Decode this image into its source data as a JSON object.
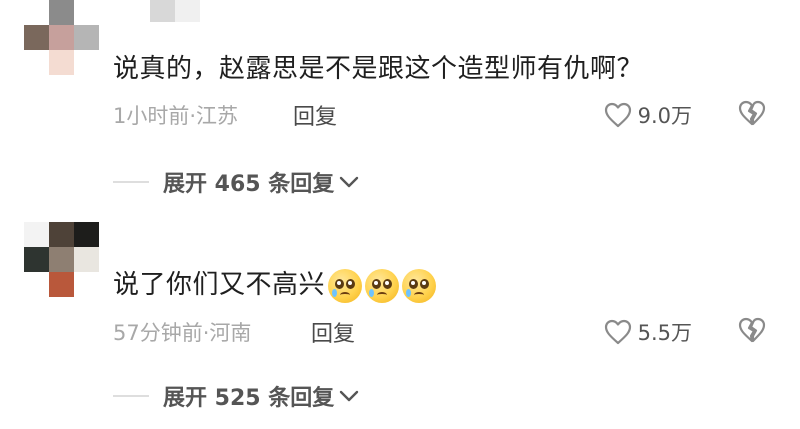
{
  "comments": [
    {
      "text": "说真的，赵露思是不是跟这个造型师有仇啊？",
      "meta": "1小时前·江苏",
      "reply_label": "回复",
      "likes": "9.0万",
      "expand_label": "展开 465 条回复",
      "avatar_colors": [
        "#ffffff",
        "#8b8b8b",
        "#ffffff",
        "#7a685c",
        "#c6a09c",
        "#b5b5b5",
        "#ffffff",
        "#f4dcd2",
        "#ffffff"
      ],
      "username_colors": [
        "#d8d8d8",
        "#f0f0f0"
      ]
    },
    {
      "text": "说了你们又不高兴",
      "meta": "57分钟前·河南",
      "reply_label": "回复",
      "likes": "5.5万",
      "expand_label": "展开 525 条回复",
      "emoji_count": 3,
      "avatar_colors": [
        "#f3f3f3",
        "#4e4238",
        "#1d1d1b",
        "#2e3430",
        "#8e7f72",
        "#e9e6e0",
        "#ffffff",
        "#b9583b",
        "#ffffff"
      ]
    }
  ],
  "icons": {
    "like": "heart-outline-icon",
    "dislike": "broken-heart-icon",
    "expand": "chevron-down-icon"
  }
}
